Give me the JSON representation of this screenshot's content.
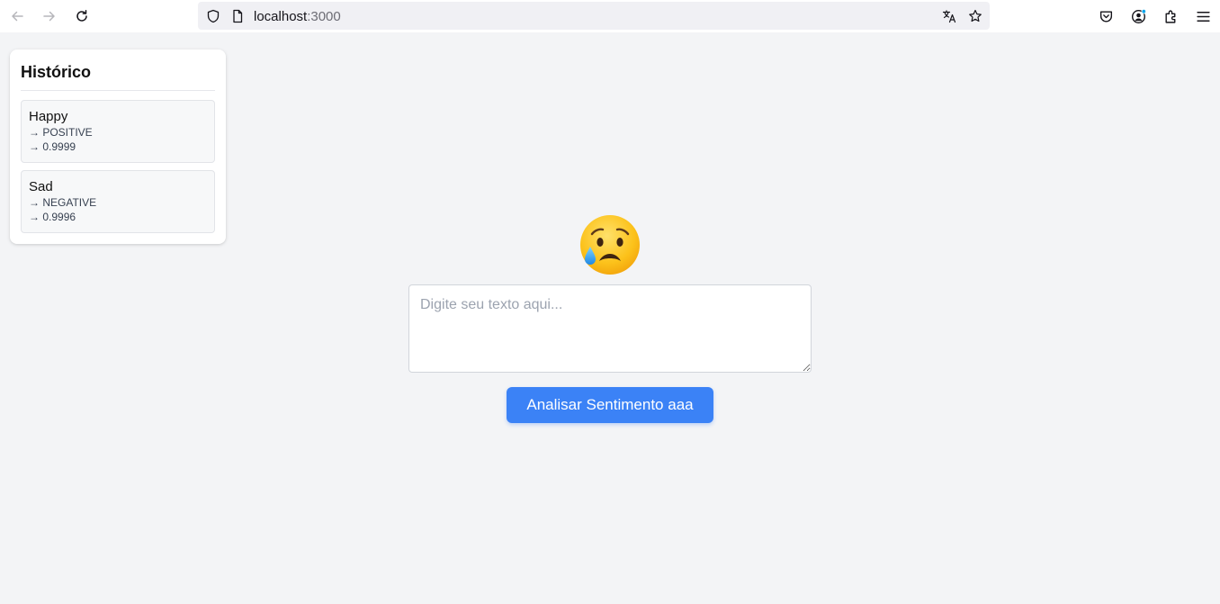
{
  "browser": {
    "url_host": "localhost",
    "url_port": ":3000",
    "icons": [
      "back-arrow-icon",
      "forward-arrow-icon",
      "reload-icon",
      "shield-icon",
      "page-icon",
      "translate-icon",
      "star-icon",
      "pocket-icon",
      "account-icon",
      "extensions-icon",
      "menu-icon"
    ]
  },
  "sidebar": {
    "title": "Histórico",
    "items": [
      {
        "text": "Happy",
        "label": "→ POSITIVE",
        "score": "→ 0.9999"
      },
      {
        "text": "Sad",
        "label": "→ NEGATIVE",
        "score": "→ 0.9996"
      }
    ]
  },
  "main": {
    "emoji": "crying-face",
    "input_placeholder": "Digite seu texto aqui...",
    "input_value": "",
    "analyze_label": "Analisar Sentimento aaa"
  },
  "colors": {
    "page_bg": "#f3f4f6",
    "button_bg": "#3b82f6",
    "button_text": "#ffffff"
  }
}
